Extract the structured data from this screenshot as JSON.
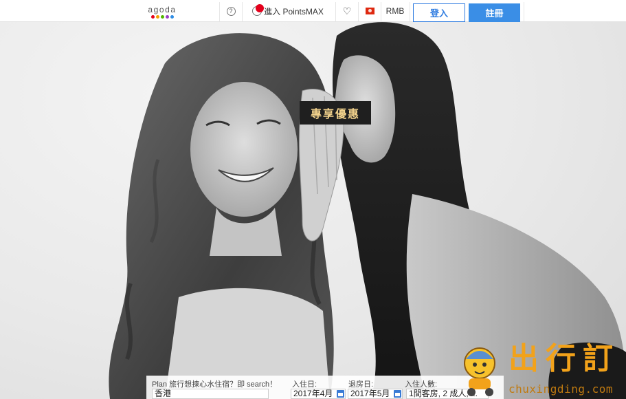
{
  "header": {
    "logo_text": "agoda",
    "logo_dot_colors": [
      "#e4001b",
      "#f4a100",
      "#52b300",
      "#9b3fc5",
      "#2f8de4"
    ],
    "help_glyph": "?",
    "pointsmax_label": "進入 PointsMAX",
    "currency": "RMB",
    "login_label": "登入",
    "register_label": "註冊"
  },
  "hero": {
    "promo_label": "專享優惠"
  },
  "search": {
    "destination_label": "Plan 旅行想揀心水住宿？即 search！",
    "destination_value": "香港",
    "checkin_label": "入住日:",
    "checkin_value": "2017年4月",
    "checkout_label": "退房日:",
    "checkout_value": "2017年5月",
    "guests_label": "入住人數:",
    "guests_value": "1間客房, 2 成人, ..."
  },
  "watermark": {
    "chars": [
      "出",
      "行",
      "訂"
    ],
    "domain": "chuxingding.com"
  },
  "colors": {
    "accent_blue": "#3a8ee6",
    "promo_gold": "#f2d28c",
    "watermark_orange": "#f2a21a"
  }
}
